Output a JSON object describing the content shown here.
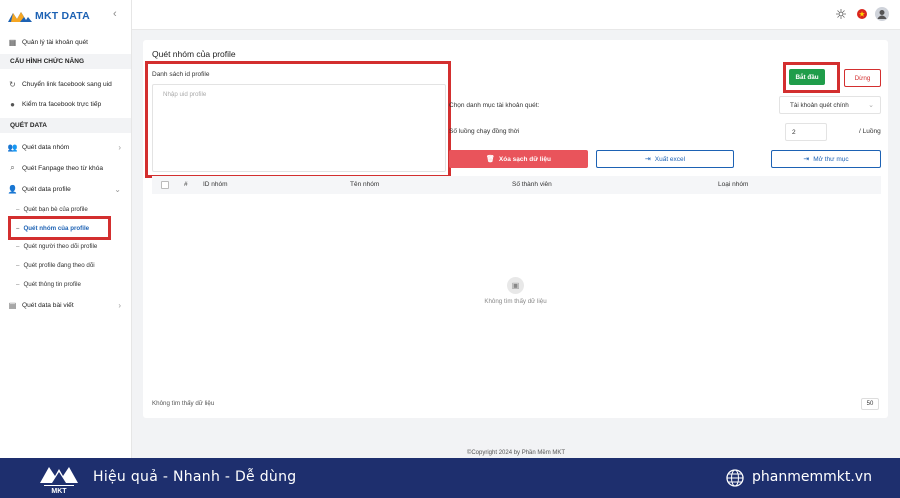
{
  "app": {
    "name": "MKT DATA"
  },
  "sidebar": {
    "items": [
      {
        "label": "Quản lý tài khoản quét"
      }
    ],
    "section_config": "CẤU HÌNH CHỨC NĂNG",
    "config_items": [
      {
        "label": "Chuyển link facebook sang uid"
      },
      {
        "label": "Kiểm tra facebook trực tiếp"
      }
    ],
    "section_data": "QUÉT DATA",
    "data_items": [
      {
        "label": "Quét data nhóm"
      },
      {
        "label": "Quét Fanpage theo từ khóa"
      },
      {
        "label": "Quét data profile"
      }
    ],
    "profile_sub_items": [
      {
        "label": "Quét bạn bè của profile"
      },
      {
        "label": "Quét nhóm của profile"
      },
      {
        "label": "Quét người theo dõi profile"
      },
      {
        "label": "Quét profile đang theo dõi"
      },
      {
        "label": "Quét thông tin profile"
      }
    ],
    "post_item": {
      "label": "Quét data bài viết"
    }
  },
  "main": {
    "title": "Quét nhóm của profile",
    "textarea_label": "Danh sách id profile",
    "textarea_placeholder": "Nhập uid profile",
    "category_label": "Chọn danh mục tài khoản quét:",
    "category_value": "Tài khoản quét chính",
    "threads_label": "Số luồng chạy đồng thời",
    "threads_value": "2",
    "threads_unit": "/ Luồng",
    "start_label": "Bắt đầu",
    "stop_label": "Dừng",
    "clear_label": "Xóa sạch dữ liệu",
    "export_label": "Xuất excel",
    "open_folder_label": "Mở thư mục",
    "table": {
      "columns": [
        "#",
        "ID nhóm",
        "Tên nhóm",
        "Số thành viên",
        "Loại nhóm"
      ]
    },
    "empty_text": "Không tìm thấy dữ liệu",
    "footer_text": "Không tìm thấy dữ liệu",
    "page_size": "50"
  },
  "copyright": "©Copyright 2024 by Phần Mềm MKT",
  "banner": {
    "slogan": "Hiệu quả - Nhanh - Dễ dùng",
    "site": "phanmemmkt.vn"
  },
  "colors": {
    "brand": "#1d62b4",
    "start": "#1f9d4a",
    "danger": "#e9545b",
    "highlight": "#d32f2f",
    "banner": "#1e2f6e"
  }
}
